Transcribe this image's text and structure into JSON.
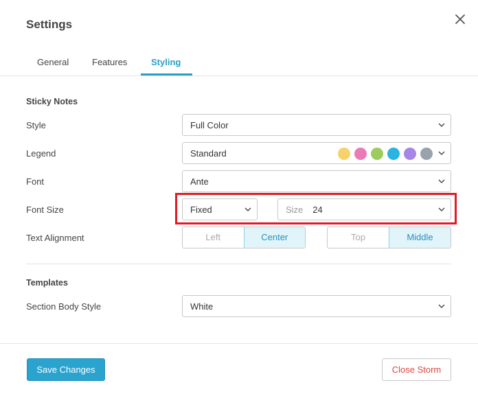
{
  "dialog": {
    "title": "Settings",
    "close_icon": "close-icon"
  },
  "tabs": [
    {
      "label": "General"
    },
    {
      "label": "Features"
    },
    {
      "label": "Styling",
      "active": true
    }
  ],
  "sticky_notes": {
    "heading": "Sticky Notes",
    "style": {
      "label": "Style",
      "value": "Full Color"
    },
    "legend": {
      "label": "Legend",
      "value": "Standard",
      "colors": [
        "#f7d26a",
        "#ea7bb6",
        "#9ccc5e",
        "#2bb3e2",
        "#a787e6",
        "#9aa3ad"
      ]
    },
    "font": {
      "label": "Font",
      "value": "Ante"
    },
    "font_size": {
      "label": "Font Size",
      "mode": "Fixed",
      "size_prefix": "Size",
      "size_value": "24"
    },
    "text_alignment": {
      "label": "Text Alignment",
      "horizontal": [
        "Left",
        "Center"
      ],
      "horizontal_selected": "Center",
      "vertical": [
        "Top",
        "Middle"
      ],
      "vertical_selected": "Middle"
    }
  },
  "templates": {
    "heading": "Templates",
    "section_body_style": {
      "label": "Section Body Style",
      "value": "White"
    }
  },
  "footer": {
    "save_label": "Save Changes",
    "close_label": "Close Storm"
  },
  "colors": {
    "accent": "#2aa3cf",
    "danger": "#e0473d",
    "highlight": "#e01b24"
  }
}
